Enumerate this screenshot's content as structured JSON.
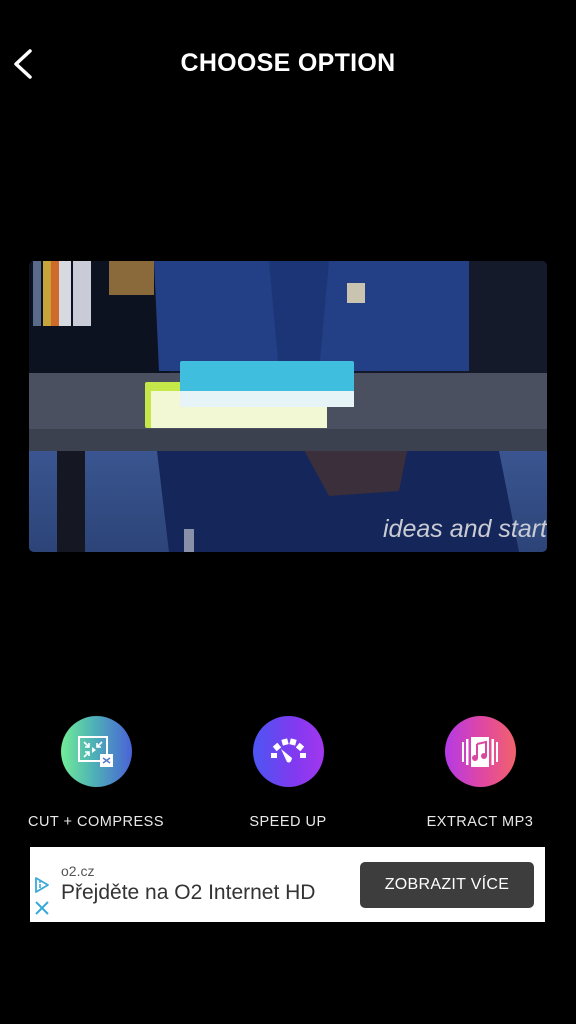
{
  "header": {
    "title": "CHOOSE OPTION",
    "back_icon": "chevron-left-icon"
  },
  "video": {
    "caption": "ideas and start"
  },
  "options": [
    {
      "label": "CUT + COMPRESS",
      "icon": "compress-icon",
      "colors": [
        "#72ec96",
        "#4a63d6"
      ]
    },
    {
      "label": "SPEED UP",
      "icon": "speedometer-icon",
      "colors": [
        "#4c55f2",
        "#a238ee"
      ]
    },
    {
      "label": "EXTRACT MP3",
      "icon": "music-file-icon",
      "colors": [
        "#b43ae6",
        "#f0636c"
      ]
    }
  ],
  "ad": {
    "domain": "o2.cz",
    "headline": "Přejděte na O2 Internet HD",
    "cta": "ZOBRAZIT VÍCE",
    "ad_icon": "adchoices-icon",
    "close_icon": "close-icon"
  }
}
